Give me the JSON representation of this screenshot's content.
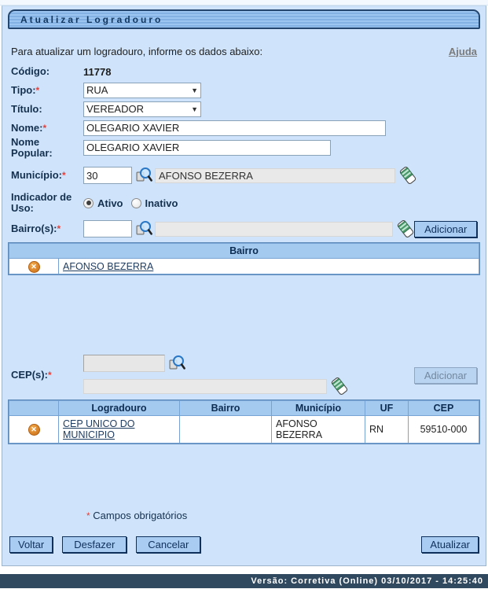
{
  "window": {
    "title": "Atualizar Logradouro"
  },
  "intro": {
    "text": "Para atualizar um logradouro, informe os dados abaixo:",
    "help_link": "Ajuda"
  },
  "form": {
    "codigo": {
      "label": "Código:",
      "value": "11778"
    },
    "tipo": {
      "label": "Tipo:",
      "required": "*",
      "value": "RUA"
    },
    "titulo": {
      "label": "Título:",
      "value": "VEREADOR"
    },
    "nome": {
      "label": "Nome:",
      "required": "*",
      "value": "OLEGARIO XAVIER"
    },
    "nome_popular": {
      "label": "Nome Popular:",
      "value": "OLEGARIO XAVIER"
    },
    "municipio": {
      "label": "Município:",
      "required": "*",
      "code": "30",
      "name": "AFONSO BEZERRA"
    },
    "indicador": {
      "label": "Indicador de Uso:",
      "options": [
        {
          "label": "Ativo",
          "selected": true
        },
        {
          "label": "Inativo",
          "selected": false
        }
      ]
    },
    "bairros": {
      "label": "Bairro(s):",
      "required": "*",
      "code": "",
      "name": "",
      "add_button": "Adicionar"
    },
    "ceps": {
      "label": "CEP(s):",
      "required": "*",
      "code": "",
      "name": "",
      "add_button": "Adicionar"
    }
  },
  "bairro_table": {
    "header": "Bairro",
    "rows": [
      {
        "name": "AFONSO BEZERRA"
      }
    ]
  },
  "cep_table": {
    "headers": {
      "logradouro": "Logradouro",
      "bairro": "Bairro",
      "municipio": "Município",
      "uf": "UF",
      "cep": "CEP"
    },
    "rows": [
      {
        "logradouro": "CEP UNICO DO MUNICIPIO",
        "bairro": "",
        "municipio": "AFONSO BEZERRA",
        "uf": "RN",
        "cep": "59510-000"
      }
    ]
  },
  "footnote": {
    "asterisk": "*",
    "text": "Campos obrigatórios"
  },
  "buttons": {
    "voltar": "Voltar",
    "desfazer": "Desfazer",
    "cancelar": "Cancelar",
    "atualizar": "Atualizar"
  },
  "statusbar": {
    "text": "Versão: Corretiva (Online) 03/10/2017 - 14:25:40"
  },
  "icons": {
    "dropdown_arrow": "▼",
    "delete_glyph": "✕"
  },
  "colors": {
    "window_bg": "#cfe4fb",
    "titlebar_stripe_light": "#9dc5f1",
    "titlebar_stripe_dark": "#84b1e4",
    "titlebar_border": "#24466e",
    "label_text": "#14304f",
    "required": "#e2413c",
    "table_header_bg": "#a5caf0",
    "button_bg": "#a9cdf2",
    "button_text": "#10305c",
    "statusbar_bg": "#30495f",
    "delete_icon": "#d9832a"
  }
}
